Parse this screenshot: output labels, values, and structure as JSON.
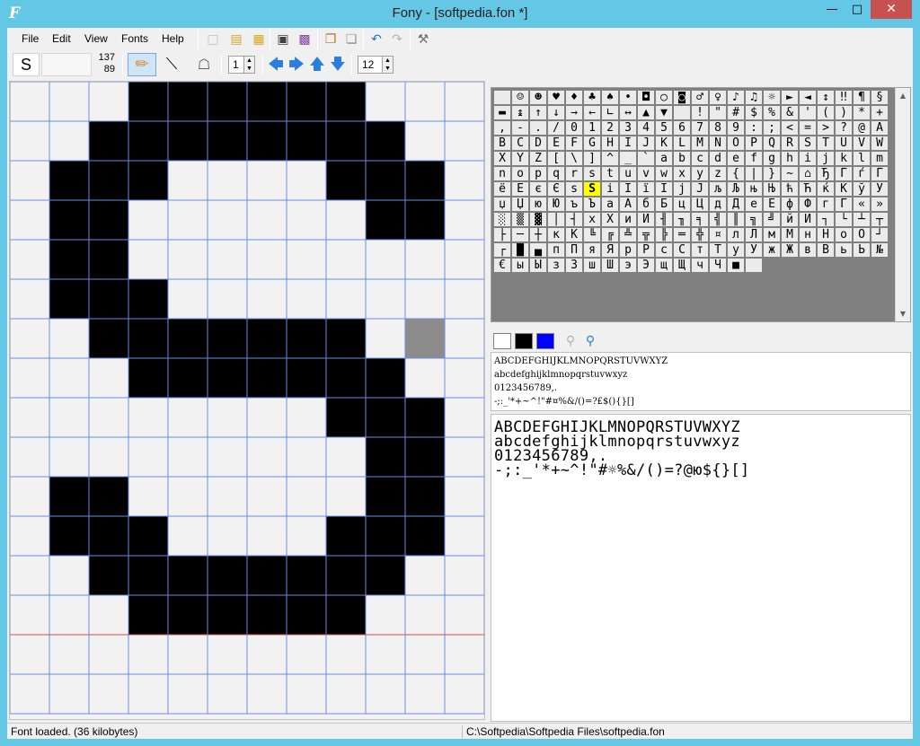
{
  "window": {
    "title": "Fony - [softpedia.fon *]",
    "app_icon": "F"
  },
  "menu": [
    "File",
    "Edit",
    "View",
    "Fonts",
    "Help"
  ],
  "toolbar": {
    "char": "S",
    "code_hex": "137",
    "code_dec": "89",
    "pen_width": "1",
    "font_height": "12",
    "icons": [
      "new-icon",
      "open-icon",
      "open-folder-icon",
      "save-icon",
      "save-as-icon",
      "copy-icon",
      "paste-icon",
      "undo-icon",
      "redo-icon",
      "settings-icon"
    ],
    "tools": [
      "pencil-icon",
      "line-icon",
      "fill-icon"
    ],
    "arrows": [
      "arrow-left-icon",
      "arrow-right-icon",
      "arrow-up-icon",
      "arrow-down-icon"
    ]
  },
  "glyph_rows": [
    "000111111000",
    "001111111100",
    "011100001110",
    "011000000110",
    "011000000000",
    "011100000000",
    "001111111000",
    "000111111100",
    "000000001110",
    "000000000110",
    "011000000110",
    "011100001110",
    "001111111100",
    "000111111000",
    "000000000000",
    "000000000000"
  ],
  "glyph_highlight": {
    "row": 6,
    "col": 10
  },
  "charmap_rows": [
    " ☺☻♥♦♣♠•◘○◙♂♀♪♫☼►◄↕‼¶§",
    "▬↨↑↓→←∟↔▲▼ !\"#$%&'()*+",
    ",-./0123456789:;<=>?@A",
    "BCDEFGHIJKLMNOPQRSTUVW",
    "XYZ[\\]^_`abcdefghijklm",
    "nopqrstuvwxyz{|}~⌂ЂЃѓЃ",
    "ёЁєЄѕSіІїЇјЈљЉњЊћЋќЌўЎ",
    "џЏюЮъЪаАбБцЦдДеЕфФгГ«»",
    "░▒▓│┤хХиИ╢╖╕╣║╗╝йЙ┐└┴┬",
    "├─┼кК╚╔╩╦╠═╬¤лЛмМнНоО┘",
    "┌█▄пПяЯрРсСтТуУжЖвВьЬ№",
    "€ыЫзЗшШэЭщЩчЧ■ "
  ],
  "charmap_selected": {
    "row": 6,
    "col": 5
  },
  "colors": {
    "white_swatch": "#ffffff",
    "black_swatch": "#000000",
    "blue_swatch": "#0000ff",
    "grid_line": "#6b8de0",
    "baseline": "#d05050"
  },
  "preview_small": [
    "ABCDEFGHIJKLMNOPQRSTUVWXYZ",
    "abcdefghijklmnopqrstuvwxyz",
    "0123456789,.",
    "-;:_'*+~^!\"#¤%&/()=?£$(){}[]"
  ],
  "preview_large": [
    "ABCDEFGHIJKLMNOPQRSTUVWXYZ",
    "abcdefghijklmnopqrstuvwxyz",
    "0123456789,.",
    "-;:_'*+~^!\"#☼%&/()=?@ю${}[]"
  ],
  "status": {
    "left": "Font loaded. (36 kilobytes)",
    "right": "C:\\Softpedia\\Softpedia Files\\softpedia.fon"
  }
}
